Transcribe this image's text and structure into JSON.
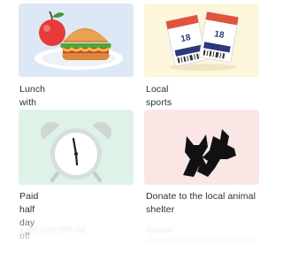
{
  "options": [
    {
      "label": "Lunch with the CEO",
      "image": "sandwich-apple-icon"
    },
    {
      "label": "Local sports team tickets",
      "image": "tickets-icon"
    },
    {
      "label": "Paid half day off",
      "image": "alarm-clock-icon"
    },
    {
      "label": "Donate to the local animal shelter",
      "image": "cat-dog-silhouette-icon"
    }
  ],
  "ticket_number": "18",
  "colors": {
    "card1_bg": "#dde8f6",
    "card2_bg": "#fbf6dc",
    "card3_bg": "#dff2e7",
    "card4_bg": "#fbe6e6",
    "text": "#2b2d3a"
  }
}
